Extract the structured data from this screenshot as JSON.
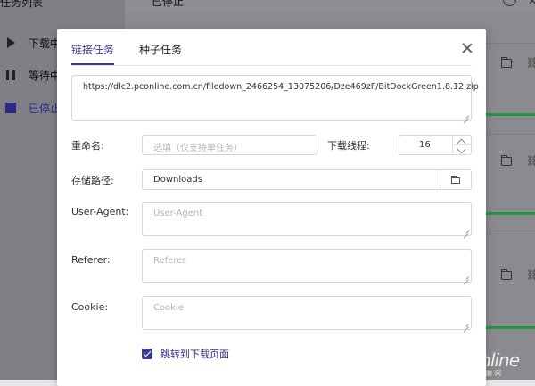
{
  "background": {
    "sidebar_title": "任务列表",
    "status_title": "已停止",
    "sidebar_items": [
      {
        "label": "下载中",
        "icon": "play-icon"
      },
      {
        "label": "等待中",
        "icon": "pause-icon"
      },
      {
        "label": "已停止",
        "icon": "stop-icon",
        "active": true
      }
    ]
  },
  "modal": {
    "tabs": [
      {
        "label": "链接任务",
        "active": true
      },
      {
        "label": "种子任务",
        "active": false
      }
    ],
    "url_value": "https://dlc2.pconline.com.cn/filedown_2466254_13075206/Dze469zF/BitDockGreen1.8.12.zip",
    "rename": {
      "label": "重命名:",
      "placeholder": "选填（仅支持单任务）"
    },
    "threads": {
      "label": "下载线程:",
      "value": "16"
    },
    "save_path": {
      "label": "存储路径:",
      "value": "Downloads"
    },
    "user_agent": {
      "label": "User-Agent:",
      "placeholder": "User-Agent"
    },
    "referer": {
      "label": "Referer:",
      "placeholder": "Referer"
    },
    "cookie": {
      "label": "Cookie:",
      "placeholder": "Cookie"
    },
    "jump_option": {
      "label": "跳转到下载页面",
      "checked": true
    }
  },
  "watermark": {
    "brand": "PConline",
    "sub": "太平洋电脑网"
  },
  "colors": {
    "accent": "#3c3a99",
    "progress": "#1e9b3e",
    "overlay": "#8a8a8f"
  }
}
